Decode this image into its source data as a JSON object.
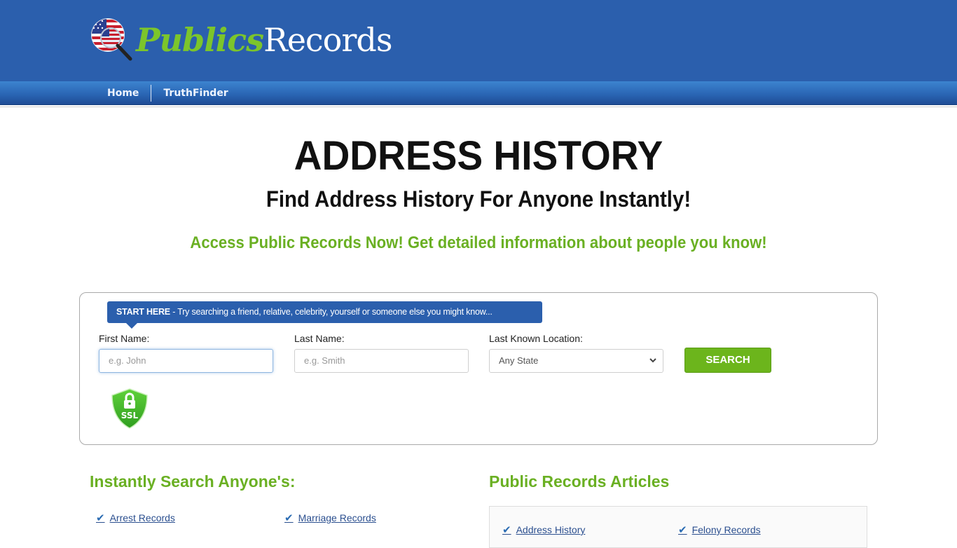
{
  "brand": {
    "name_part1": "Publics",
    "name_part2": "Records",
    "colors": {
      "header_blue": "#2b5fad",
      "brand_green": "#7cc52b",
      "accent_green": "#6ab023",
      "button_green": "#6cb51c"
    }
  },
  "nav": {
    "items": [
      {
        "label": "Home"
      },
      {
        "label": "TruthFinder"
      }
    ]
  },
  "hero": {
    "title": "ADDRESS HISTORY",
    "subtitle": "Find Address History For Anyone Instantly!",
    "tagline": "Access Public Records Now! Get detailed information about people you know!"
  },
  "search": {
    "tip_strong": "START HERE",
    "tip_text": " - Try searching a friend, relative, celebrity, yourself or someone else you might know...",
    "first_name_label": "First Name:",
    "first_name_placeholder": "e.g. John",
    "last_name_label": "Last Name:",
    "last_name_placeholder": "e.g. Smith",
    "location_label": "Last Known Location:",
    "location_selected": "Any State",
    "button_label": "SEARCH",
    "ssl_label": "SSL"
  },
  "instant_search": {
    "title": "Instantly Search Anyone's:",
    "links": [
      {
        "label": "Arrest Records"
      },
      {
        "label": "Marriage Records"
      }
    ]
  },
  "articles": {
    "title": "Public Records Articles",
    "links": [
      {
        "label": "Address History"
      },
      {
        "label": "Felony Records"
      }
    ]
  }
}
